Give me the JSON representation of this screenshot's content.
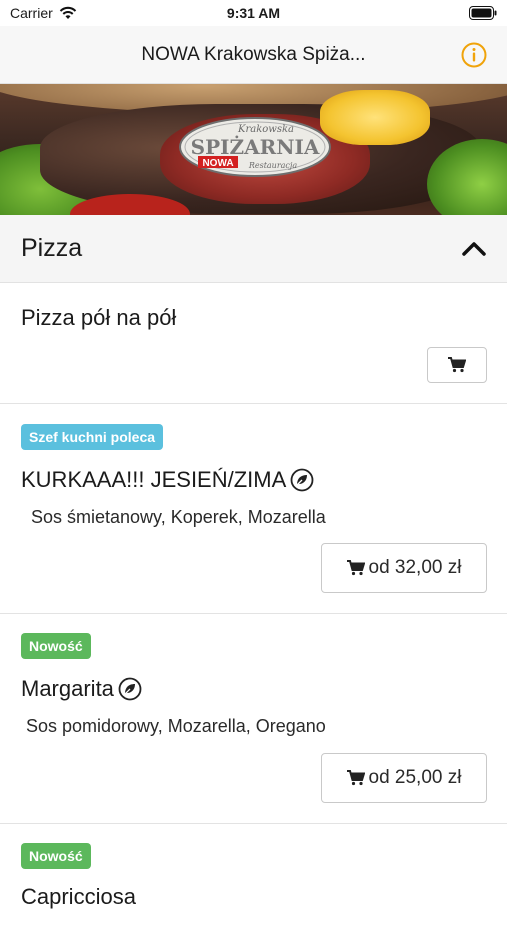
{
  "status_bar": {
    "carrier": "Carrier",
    "time": "9:31 AM"
  },
  "nav": {
    "title": "NOWA Krakowska Spiża..."
  },
  "hero": {
    "logo_top_text": "Krakowska",
    "logo_main_text": "SPIŻARNIA",
    "logo_badge_text": "NOWA",
    "logo_bottom_text": "Restauracja"
  },
  "section": {
    "title": "Pizza"
  },
  "items": [
    {
      "name": "Pizza pół na pół"
    },
    {
      "badge": "Szef kuchni poleca",
      "name": "KURKAAA!!! JESIEŃ/ZIMA",
      "description": "Sos śmietanowy, Koperek, Mozarella",
      "price": "od 32,00 zł"
    },
    {
      "badge": "Nowość",
      "name": "Margarita",
      "description": "Sos pomidorowy, Mozarella, Oregano",
      "price": "od 25,00 zł"
    },
    {
      "badge": "Nowość",
      "name": "Capricciosa"
    }
  ],
  "colors": {
    "accent_info": "#f0a30a",
    "badge_chef": "#5bc0de",
    "badge_new": "#5cb85c"
  }
}
